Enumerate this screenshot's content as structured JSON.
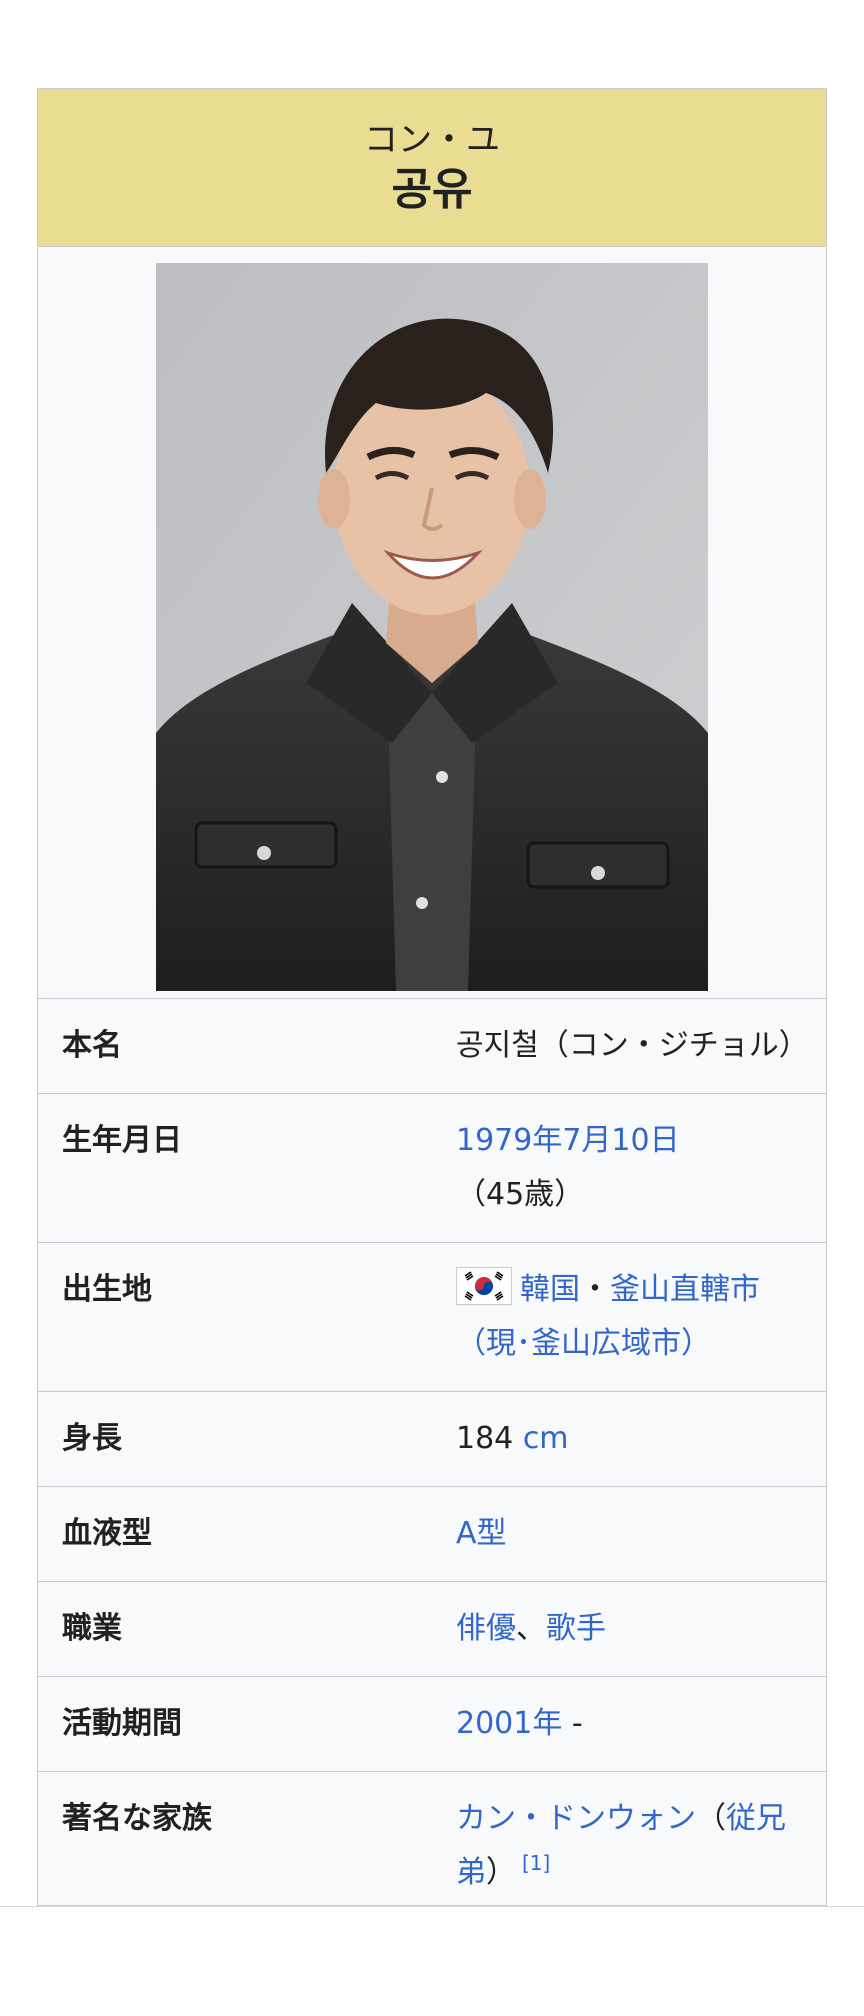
{
  "header": {
    "kana_name": "コン・ユ",
    "hangul_name": "공유"
  },
  "portrait": {
    "background": "#c2c3c6",
    "jacket_color": "#2c2b2c",
    "skin_color": "#e8c2a6",
    "hair_color": "#2b211c"
  },
  "rows": {
    "real_name": {
      "label": "本名",
      "value": "공지철（コン・ジチョル）"
    },
    "birth_date": {
      "label": "生年月日",
      "date_link": "1979年7月10日",
      "age_text": "（45歳）"
    },
    "birth_place": {
      "label": "出生地",
      "flag": "south-korea-flag",
      "country_link": "韓国",
      "separator": "・",
      "city_link": "釜山直轄市",
      "current_link": "（現･釜山広域市）"
    },
    "height": {
      "label": "身長",
      "number": "184",
      "unit_link": "cm"
    },
    "blood_type": {
      "label": "血液型",
      "value_link": "A型"
    },
    "occupation": {
      "label": "職業",
      "link1": "俳優",
      "separator": "、",
      "link2": "歌手"
    },
    "active_period": {
      "label": "活動期間",
      "year_link": "2001年",
      "suffix": " -"
    },
    "notable_family": {
      "label": "著名な家族",
      "name_link": "カン・ドンウォン",
      "open_paren": "（",
      "relation_link": "従兄弟",
      "close_paren": "）",
      "ref": "[1]"
    }
  }
}
